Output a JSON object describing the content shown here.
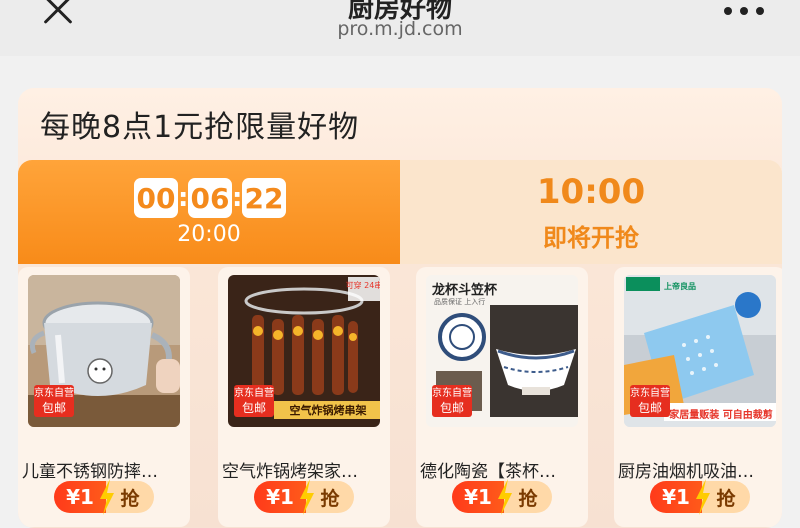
{
  "topbar": {
    "title": "厨房好物",
    "url": "pro.m.jd.com"
  },
  "headline": "每晚8点1元抢限量好物",
  "tabs": [
    {
      "countdown": [
        "00",
        "06",
        "22"
      ],
      "time": "20:00",
      "active": true
    },
    {
      "time": "10:00",
      "status": "即将开抢",
      "active": false
    }
  ],
  "badge": {
    "line1": "京东自营",
    "line2": "包邮"
  },
  "products": [
    {
      "name": "儿童不锈钢防摔…",
      "price": "¥1",
      "buy_label": "抢"
    },
    {
      "name": "空气炸锅烤架家…",
      "price": "¥1",
      "buy_label": "抢",
      "image_text": "空气炸锅烤串架",
      "corner_text": "可穿 24串"
    },
    {
      "name": "德化陶瓷【茶杯…",
      "price": "¥1",
      "buy_label": "抢",
      "image_text": "龙杯斗笠杯",
      "image_subtext": "品质保证 上入行"
    },
    {
      "name": "厨房油烟机吸油…",
      "price": "¥1",
      "buy_label": "抢",
      "image_text": "家居量贩装 可自由裁剪",
      "corner_text": "上帝良品"
    }
  ],
  "colors": {
    "accent": "#f88b19",
    "price": "#ff3a1a",
    "badge": "#e62e1f"
  }
}
